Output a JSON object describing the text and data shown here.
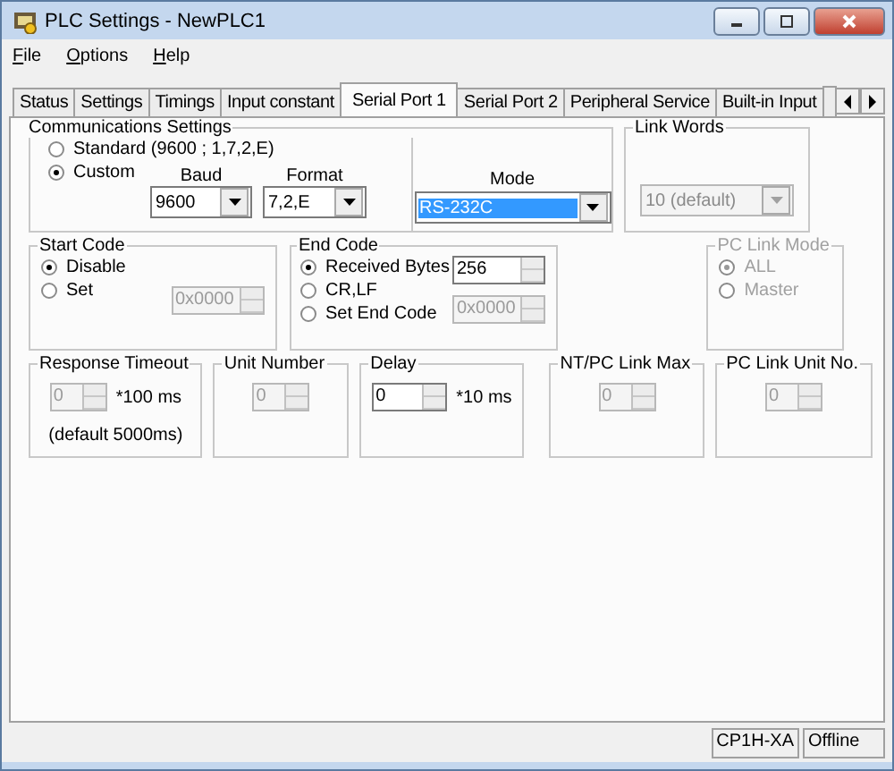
{
  "window": {
    "title": "PLC Settings - NewPLC1"
  },
  "menu": [
    {
      "label": "File"
    },
    {
      "label": "Options"
    },
    {
      "label": "Help"
    }
  ],
  "tabs": [
    {
      "label": "Status",
      "selected": false
    },
    {
      "label": "Settings",
      "selected": false
    },
    {
      "label": "Timings",
      "selected": false
    },
    {
      "label": "Input constant",
      "selected": false
    },
    {
      "label": "Serial Port 1",
      "selected": true
    },
    {
      "label": "Serial Port 2",
      "selected": false
    },
    {
      "label": "Peripheral Service",
      "selected": false
    },
    {
      "label": "Built-in Input",
      "selected": false
    }
  ],
  "communications": {
    "legend": "Communications Settings",
    "options": [
      {
        "label": "Standard (9600 ; 1,7,2,E)",
        "selected": false
      },
      {
        "label": "Custom",
        "selected": true
      }
    ],
    "baud": {
      "label": "Baud",
      "value": "9600"
    },
    "format": {
      "label": "Format",
      "value": "7,2,E"
    },
    "mode": {
      "label": "Mode",
      "value": "RS-232C"
    }
  },
  "link_words": {
    "legend": "Link Words",
    "value": "10 (default)",
    "disabled": true
  },
  "start_code": {
    "legend": "Start Code",
    "options": [
      {
        "label": "Disable",
        "selected": true
      },
      {
        "label": "Set",
        "selected": false
      }
    ],
    "value": "0x0000",
    "disabled": true
  },
  "end_code": {
    "legend": "End Code",
    "options": [
      {
        "label": "Received Bytes",
        "selected": true
      },
      {
        "label": "CR,LF",
        "selected": false
      },
      {
        "label": "Set End Code",
        "selected": false
      }
    ],
    "received_value": "256",
    "set_value": "0x0000"
  },
  "pc_link_mode": {
    "legend": "PC Link Mode",
    "disabled": true,
    "options": [
      {
        "label": "ALL",
        "selected": true
      },
      {
        "label": "Master",
        "selected": false
      }
    ]
  },
  "bottom_groups": [
    {
      "legend": "Response Timeout",
      "value": "0",
      "disabled": true,
      "unit": "*100 ms",
      "note": "(default 5000ms)"
    },
    {
      "legend": "Unit Number",
      "value": "0",
      "disabled": true
    },
    {
      "legend": "Delay",
      "value": "0",
      "disabled": false,
      "unit": "*10 ms"
    },
    {
      "legend": "NT/PC Link Max",
      "value": "0",
      "disabled": true
    },
    {
      "legend": "PC Link Unit No.",
      "value": "0",
      "disabled": true
    }
  ],
  "status_bar": [
    "CP1H-XA",
    "Offline"
  ]
}
